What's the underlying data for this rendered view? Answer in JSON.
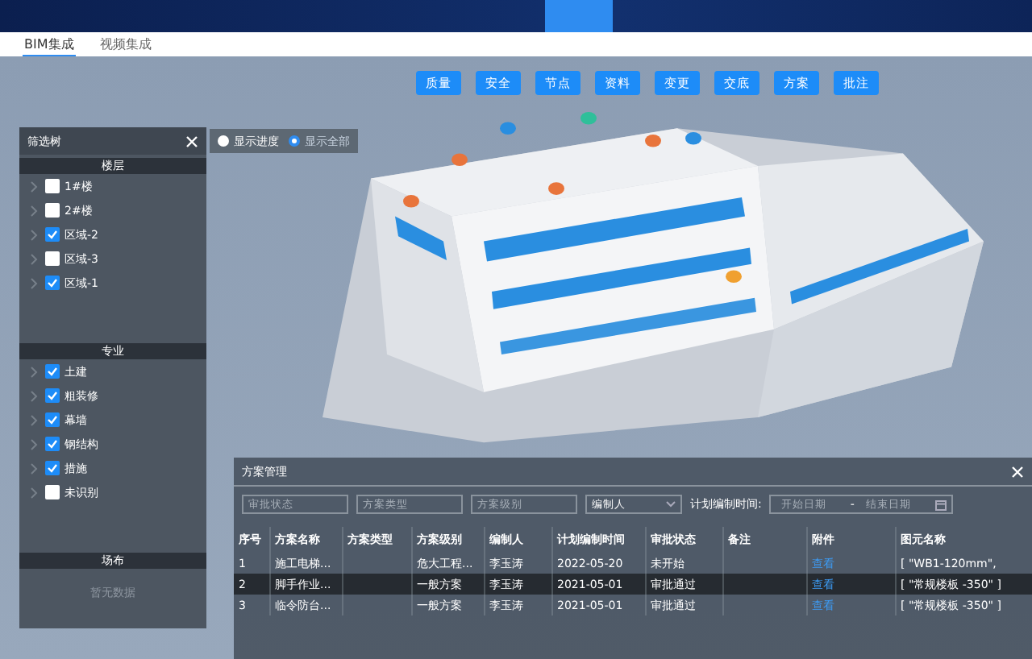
{
  "sub_tabs": [
    {
      "label": "BIM集成",
      "selected": true
    },
    {
      "label": "视频集成",
      "selected": false
    }
  ],
  "tool_buttons": [
    "质量",
    "安全",
    "节点",
    "资料",
    "变更",
    "交底",
    "方案",
    "批注"
  ],
  "display_options": [
    {
      "label": "显示进度",
      "selected": false
    },
    {
      "label": "显示全部",
      "selected": true
    }
  ],
  "filter_panel": {
    "title": "筛选树",
    "sections": [
      {
        "title": "楼层",
        "items": [
          {
            "label": "1#楼",
            "checked": false
          },
          {
            "label": "2#楼",
            "checked": false
          },
          {
            "label": "区域-2",
            "checked": true
          },
          {
            "label": "区域-3",
            "checked": false
          },
          {
            "label": "区域-1",
            "checked": true
          }
        ]
      },
      {
        "title": "专业",
        "items": [
          {
            "label": "土建",
            "checked": true
          },
          {
            "label": "粗装修",
            "checked": true
          },
          {
            "label": "幕墙",
            "checked": true
          },
          {
            "label": "钢结构",
            "checked": true
          },
          {
            "label": "措施",
            "checked": true
          },
          {
            "label": "未识别",
            "checked": false
          }
        ]
      },
      {
        "title": "场布",
        "empty_text": "暂无数据"
      }
    ]
  },
  "plan_panel": {
    "title": "方案管理",
    "filters": {
      "status_placeholder": "审批状态",
      "type_placeholder": "方案类型",
      "level_placeholder": "方案级别",
      "author": "编制人",
      "date_label": "计划编制时间:",
      "start_placeholder": "开始日期",
      "range_separator": "-",
      "end_placeholder": "结束日期"
    },
    "columns": [
      "序号",
      "方案名称",
      "方案类型",
      "方案级别",
      "编制人",
      "计划编制时间",
      "审批状态",
      "备注",
      "附件",
      "图元名称"
    ],
    "rows": [
      {
        "selected": false,
        "cells": [
          "1",
          "施工电梯...",
          "",
          "危大工程...",
          "李玉涛",
          "2022-05-20",
          "未开始",
          "",
          "查看",
          "[ \"WB1-120mm\","
        ]
      },
      {
        "selected": true,
        "cells": [
          "2",
          "脚手作业...",
          "",
          "一般方案",
          "李玉涛",
          "2021-05-01",
          "审批通过",
          "",
          "查看",
          "[ \"常规楼板 -350\" ]"
        ]
      },
      {
        "selected": false,
        "cells": [
          "3",
          "临令防台...",
          "",
          "一般方案",
          "李玉涛",
          "2021-05-01",
          "审批通过",
          "",
          "查看",
          "[ \"常规楼板 -350\" ]"
        ]
      }
    ]
  }
}
